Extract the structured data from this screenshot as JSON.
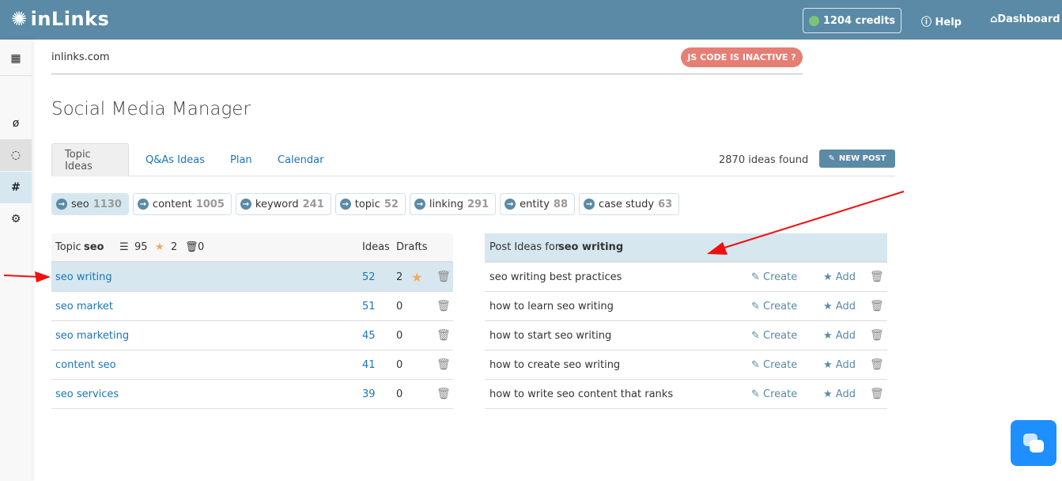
{
  "header": {
    "logo": "inLinks",
    "credits": "1204 credits",
    "help": "Help",
    "dashboard": "Dashboard"
  },
  "site": "inlinks.com",
  "js_badge": "JS CODE IS INACTIVE",
  "title": "Social Media Manager",
  "tabs": [
    {
      "label": "Topic Ideas"
    },
    {
      "label": "Q&As Ideas"
    },
    {
      "label": "Plan"
    },
    {
      "label": "Calendar"
    }
  ],
  "ideas_found": "2870 ideas found",
  "new_post": "NEW POST",
  "chips": [
    {
      "label": "seo",
      "count": "1130"
    },
    {
      "label": "content",
      "count": "1005"
    },
    {
      "label": "keyword",
      "count": "241"
    },
    {
      "label": "topic",
      "count": "52"
    },
    {
      "label": "linking",
      "count": "291"
    },
    {
      "label": "entity",
      "count": "88"
    },
    {
      "label": "case study",
      "count": "63"
    }
  ],
  "topics": {
    "header_prefix": "Topic",
    "header_topic": "seo",
    "list_count": "95",
    "star_count": "2",
    "trash_count": "0",
    "col_ideas": "Ideas",
    "col_drafts": "Drafts",
    "rows": [
      {
        "name": "seo writing",
        "ideas": "52",
        "drafts": "2"
      },
      {
        "name": "seo market",
        "ideas": "51",
        "drafts": "0"
      },
      {
        "name": "seo marketing",
        "ideas": "45",
        "drafts": "0"
      },
      {
        "name": "content seo",
        "ideas": "41",
        "drafts": "0"
      },
      {
        "name": "seo services",
        "ideas": "39",
        "drafts": "0"
      }
    ]
  },
  "posts": {
    "header_prefix": "Post Ideas for",
    "header_topic": "seo writing",
    "create": "Create",
    "add": "Add",
    "rows": [
      "seo writing best practices",
      "how to learn seo writing",
      "how to start seo writing",
      "how to create seo writing",
      "how to write seo content that ranks"
    ]
  }
}
